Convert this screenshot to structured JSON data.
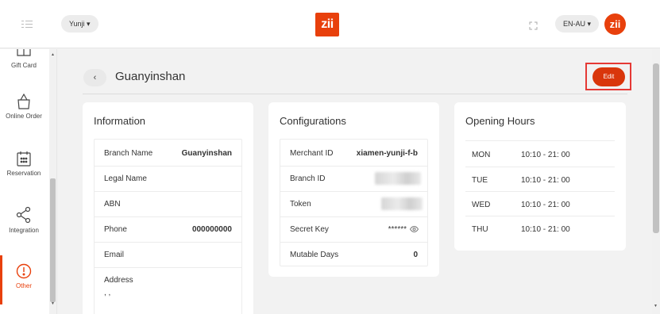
{
  "topbar": {
    "user_selector": "Yunji ▾",
    "brand_logo": "zii",
    "language_selector": "EN-AU ▾",
    "avatar_logo": "zii"
  },
  "sidebar": {
    "items": [
      {
        "label": "Gift Card",
        "icon": "gift-card-icon"
      },
      {
        "label": "Online Order",
        "icon": "shopping-bag-icon"
      },
      {
        "label": "Reservation",
        "icon": "calendar-icon"
      },
      {
        "label": "Integration",
        "icon": "share-icon"
      },
      {
        "label": "Other",
        "icon": "alert-circle-icon",
        "active": true
      }
    ]
  },
  "header": {
    "back_label": "‹",
    "title": "Guanyinshan",
    "edit_label": "Edit"
  },
  "information": {
    "title": "Information",
    "rows": [
      {
        "label": "Branch Name",
        "value": "Guanyinshan"
      },
      {
        "label": "Legal Name",
        "value": ""
      },
      {
        "label": "ABN",
        "value": ""
      },
      {
        "label": "Phone",
        "value": "000000000"
      },
      {
        "label": "Email",
        "value": ""
      },
      {
        "label": "Address",
        "value": ", ,"
      }
    ]
  },
  "configurations": {
    "title": "Configurations",
    "rows": [
      {
        "label": "Merchant ID",
        "value": "xiamen-yunji-f-b"
      },
      {
        "label": "Branch ID",
        "value": ""
      },
      {
        "label": "Token",
        "value": ""
      },
      {
        "label": "Secret Key",
        "value": "******"
      },
      {
        "label": "Mutable Days",
        "value": "0"
      }
    ]
  },
  "opening_hours": {
    "title": "Opening Hours",
    "rows": [
      {
        "day": "MON",
        "time": "10:10 - 21: 00"
      },
      {
        "day": "TUE",
        "time": "10:10 - 21: 00"
      },
      {
        "day": "WED",
        "time": "10:10 - 21: 00"
      },
      {
        "day": "THU",
        "time": "10:10 - 21: 00"
      }
    ]
  },
  "colors": {
    "accent": "#e8400c",
    "highlight_box": "#e53935"
  }
}
